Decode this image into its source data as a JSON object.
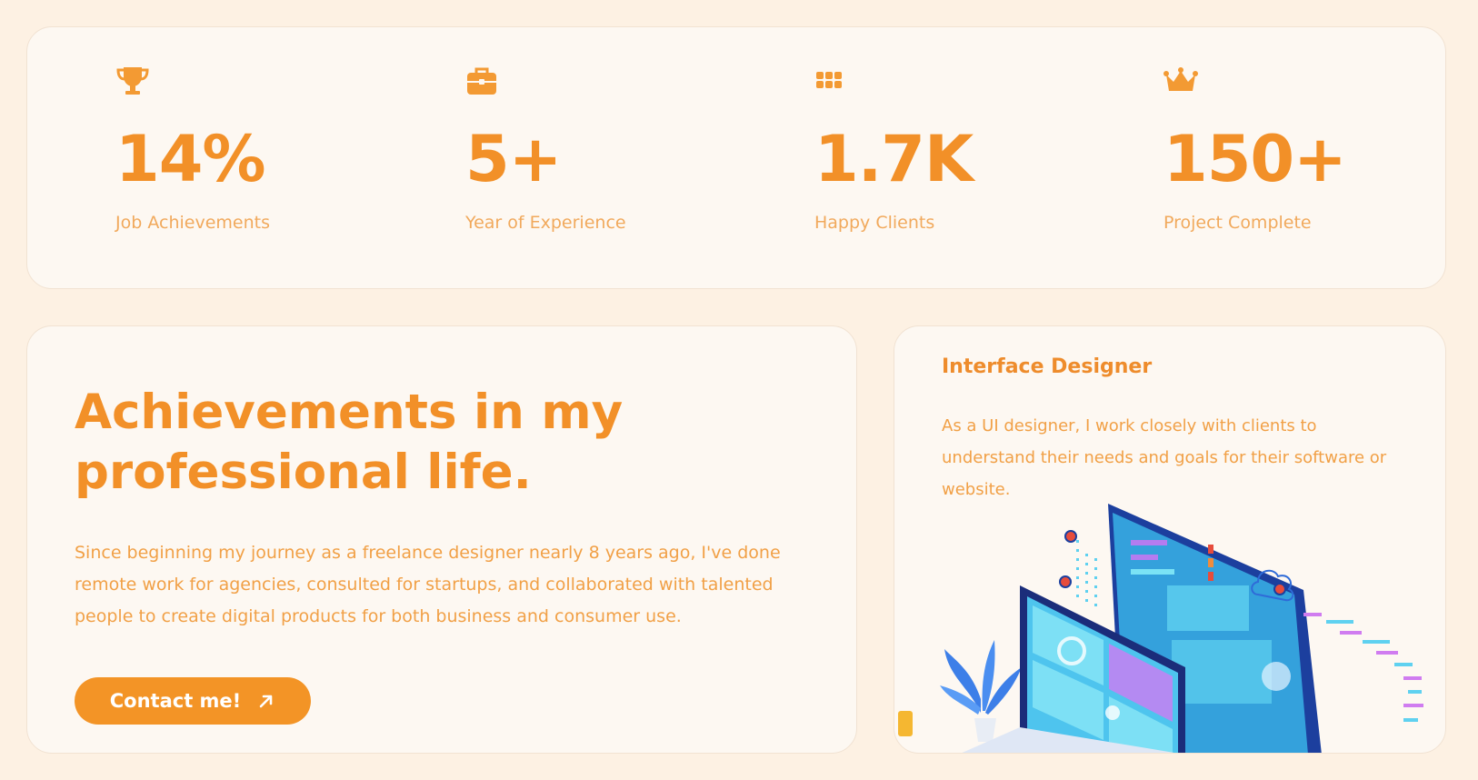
{
  "stats": [
    {
      "icon": "trophy-icon",
      "value": "14%",
      "label": "Job Achievements"
    },
    {
      "icon": "briefcase-icon",
      "value": "5+",
      "label": "Year of Experience"
    },
    {
      "icon": "grid-icon",
      "value": "1.7K",
      "label": "Happy Clients"
    },
    {
      "icon": "crown-icon",
      "value": "150+",
      "label": "Project Complete"
    }
  ],
  "about": {
    "heading_line1": "Achievements in my",
    "heading_line2": "professional life.",
    "text": "Since beginning my journey as a freelance designer nearly 8 years ago, I've done remote work for agencies, consulted for startups, and collaborated with talented people to create digital products for both business and consumer use.",
    "button_label": "Contact me!",
    "button_icon": "arrow-up-right-icon"
  },
  "designer": {
    "title": "Interface Designer",
    "text": "As a UI designer, I work closely with clients to understand their needs and goals for their software or website."
  },
  "colors": {
    "background": "#fdf1e3",
    "card": "#fdf8f2",
    "accent": "#f39426",
    "muted_accent": "#f1a95c"
  }
}
